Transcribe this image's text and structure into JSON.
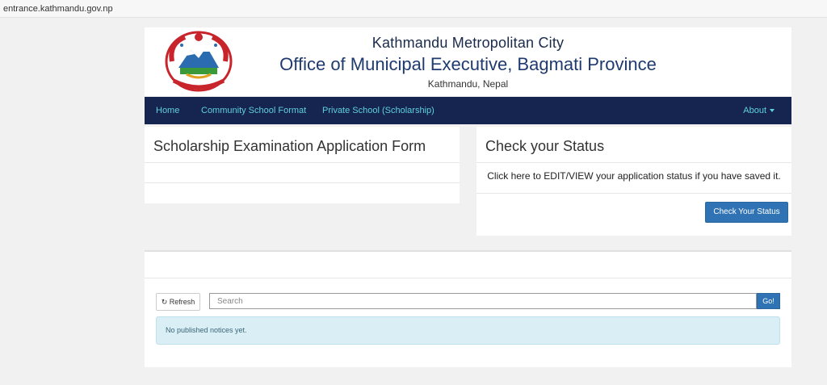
{
  "browser": {
    "url": "entrance.kathmandu.gov.np"
  },
  "header": {
    "line1": "Kathmandu Metropolitan City",
    "line2": "Office of Municipal Executive, Bagmati Province",
    "line3": "Kathmandu, Nepal"
  },
  "nav": {
    "home": "Home",
    "community": "Community School Format",
    "private": "Private School (Scholarship)",
    "about": "About"
  },
  "form_panel": {
    "title": "Scholarship Examination Application Form"
  },
  "status_panel": {
    "title": "Check your Status",
    "text": "Click here to EDIT/VIEW your application status if you have saved it.",
    "button": "Check Your Status"
  },
  "notices": {
    "refresh": "Refresh",
    "search_placeholder": "Search",
    "go": "Go!",
    "empty": "No published notices yet."
  },
  "colors": {
    "navbar": "#16254f",
    "nav_link": "#5fd0e0",
    "primary": "#2f73b4",
    "alert_bg": "#d9eef5"
  }
}
